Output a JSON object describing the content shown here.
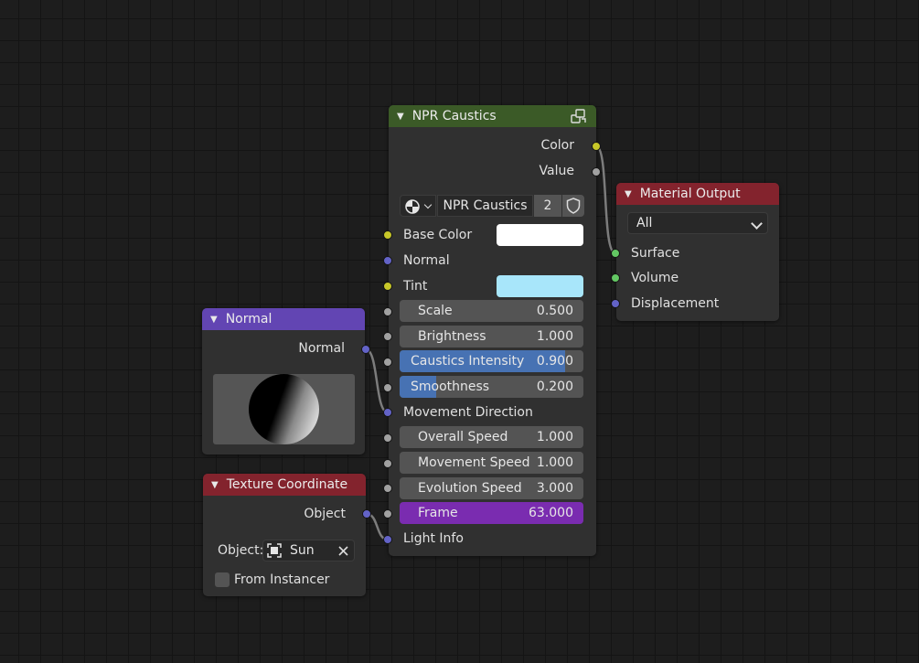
{
  "npr_caustics": {
    "title": "NPR Caustics",
    "outputs": [
      "Color",
      "Value"
    ],
    "group_name": "NPR Caustics",
    "users": "2",
    "base_color_label": "Base Color",
    "base_color_value": "#ffffff",
    "normal_label": "Normal",
    "tint_label": "Tint",
    "tint_value": "#a8e6fa",
    "fields": [
      {
        "label": "Scale",
        "value": "0.500",
        "fill": 0
      },
      {
        "label": "Brightness",
        "value": "1.000",
        "fill": 0
      },
      {
        "label": "Caustics Intensity",
        "value": "0.900",
        "fill": 0.9
      },
      {
        "label": "Smoothness",
        "value": "0.200",
        "fill": 0.2
      }
    ],
    "movement_direction_label": "Movement Direction",
    "fields2": [
      {
        "label": "Overall Speed",
        "value": "1.000"
      },
      {
        "label": "Movement Speed",
        "value": "1.000"
      },
      {
        "label": "Evolution Speed",
        "value": "3.000"
      }
    ],
    "frame": {
      "label": "Frame",
      "value": "63.000"
    },
    "light_info_label": "Light Info"
  },
  "material_output": {
    "title": "Material Output",
    "target": "All",
    "inputs": [
      "Surface",
      "Volume",
      "Displacement"
    ]
  },
  "normal_node": {
    "title": "Normal",
    "output": "Normal"
  },
  "texture_coordinate": {
    "title": "Texture Coordinate",
    "output": "Object",
    "object_label": "Object:",
    "object_value": "Sun",
    "from_instancer_label": "From Instancer",
    "from_instancer_checked": false
  },
  "colors": {
    "group_header": "#3b5a27",
    "output_header": "#83232d",
    "vector_header": "#6245b3",
    "input_header": "#83232d",
    "socket_color": "#c7c729",
    "socket_vector": "#6363c7",
    "socket_float": "#a1a1a1",
    "socket_shader": "#63c763",
    "field_fill": "#4772b3",
    "frame_field": "#7a2cb0"
  }
}
